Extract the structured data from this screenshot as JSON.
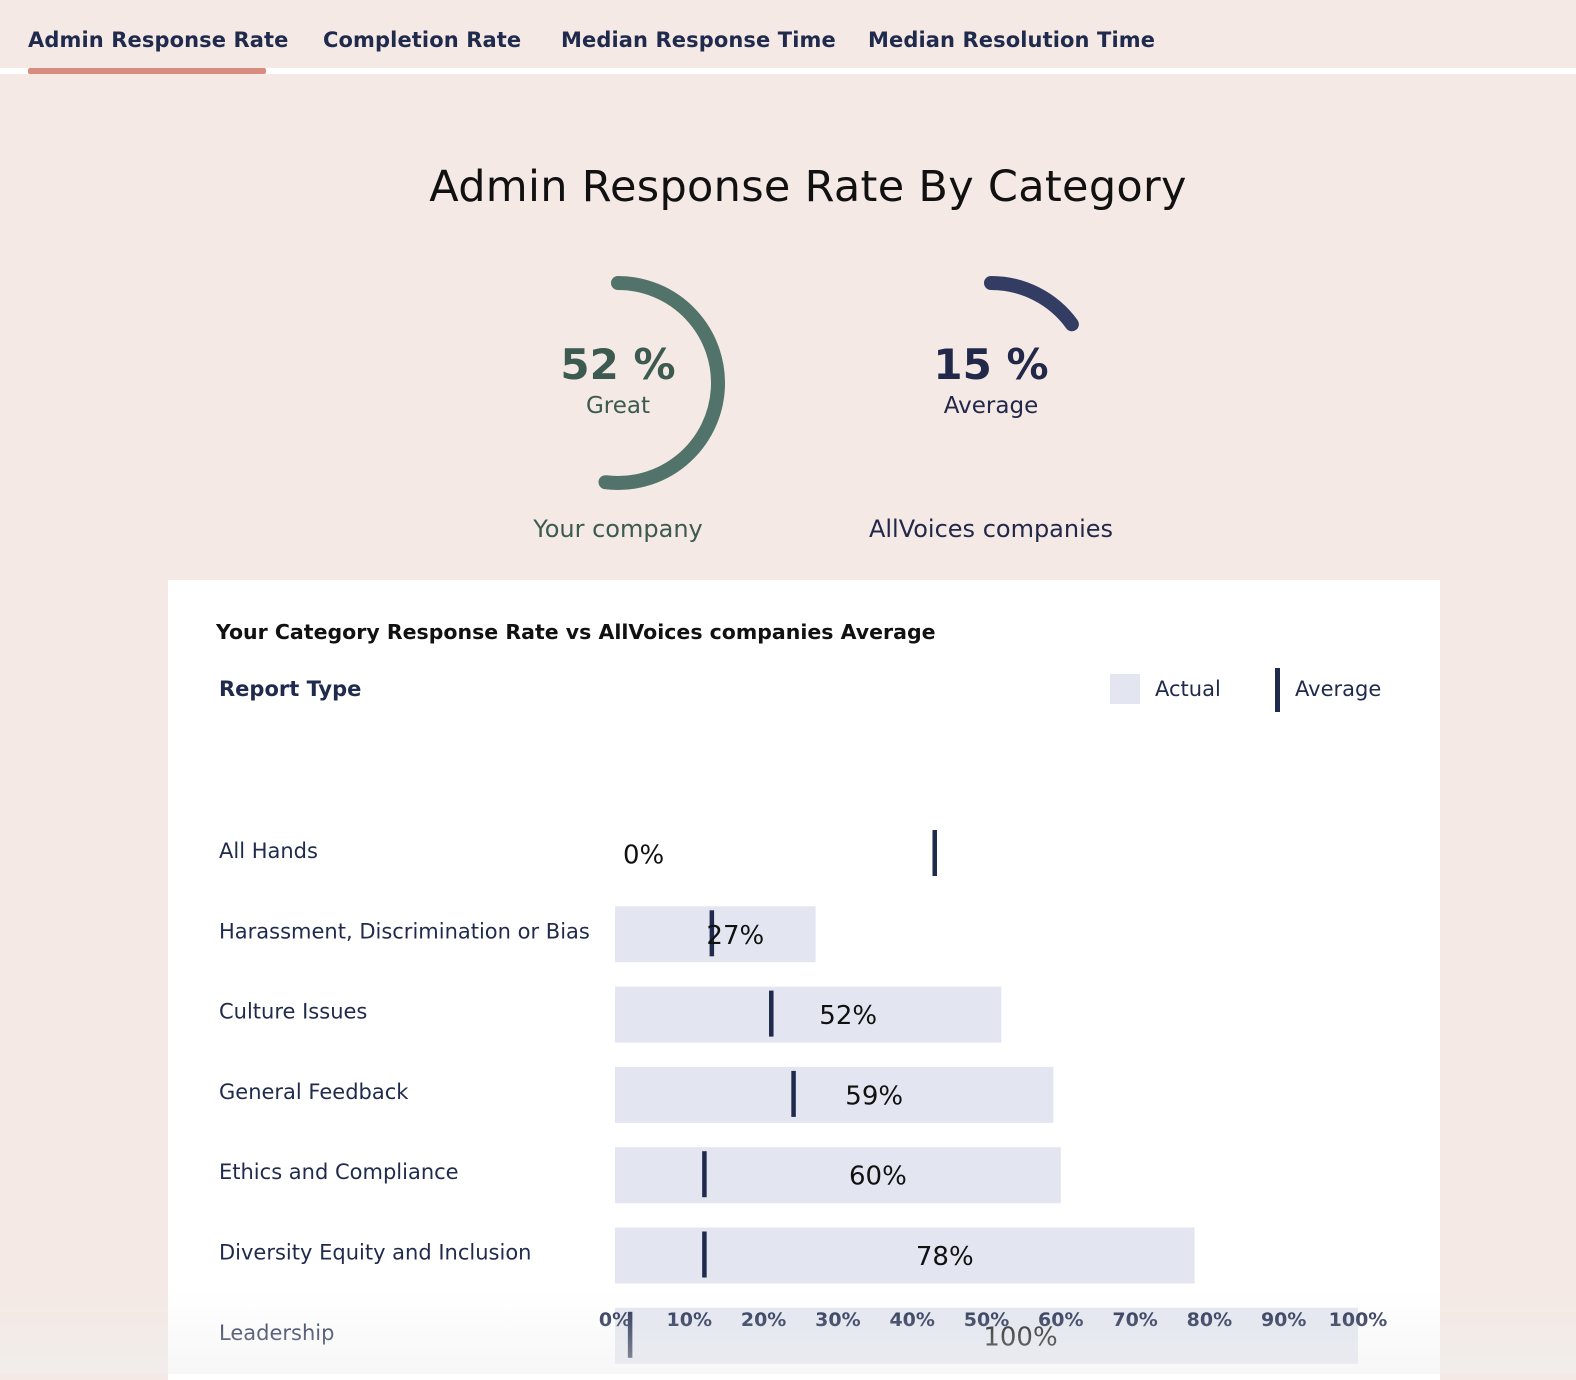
{
  "tabs": [
    {
      "label": "Admin Response Rate",
      "active": true
    },
    {
      "label": "Completion Rate",
      "active": false
    },
    {
      "label": "Median Response Time",
      "active": false
    },
    {
      "label": "Median Resolution Time",
      "active": false
    }
  ],
  "title": "Admin Response Rate By Category",
  "gauges": {
    "company": {
      "value_text": "52 %",
      "value": 52,
      "label": "Great",
      "caption": "Your company",
      "color": "#52736a"
    },
    "allvoices": {
      "value_text": "15 %",
      "value": 15,
      "label": "Average",
      "caption": "AllVoices companies",
      "color": "#333c63"
    }
  },
  "panel": {
    "title": "Your Category Response Rate vs AllVoices companies Average",
    "report_type_label": "Report Type",
    "legend": {
      "actual": "Actual",
      "average": "Average"
    }
  },
  "colors": {
    "bar": "#e3e6f0",
    "marker": "#1f2a4d",
    "text": "#1f2a4d"
  },
  "chart_data": {
    "type": "bar",
    "orientation": "horizontal",
    "categories": [
      "All Hands",
      "Harassment, Discrimination or Bias",
      "Culture Issues",
      "General Feedback",
      "Ethics and Compliance",
      "Diversity Equity and Inclusion",
      "Leadership"
    ],
    "series": [
      {
        "name": "Actual",
        "values": [
          0,
          27,
          52,
          59,
          60,
          78,
          100
        ]
      },
      {
        "name": "Average",
        "values": [
          43,
          13,
          21,
          24,
          12,
          12,
          2
        ]
      }
    ],
    "value_labels": [
      "0%",
      "27%",
      "52%",
      "59%",
      "60%",
      "78%",
      "100%"
    ],
    "xlim": [
      0,
      100
    ],
    "xticks": [
      "0%",
      "10%",
      "20%",
      "30%",
      "40%",
      "50%",
      "60%",
      "70%",
      "80%",
      "90%",
      "100%"
    ],
    "legend_position": "top-right",
    "grid": false
  }
}
